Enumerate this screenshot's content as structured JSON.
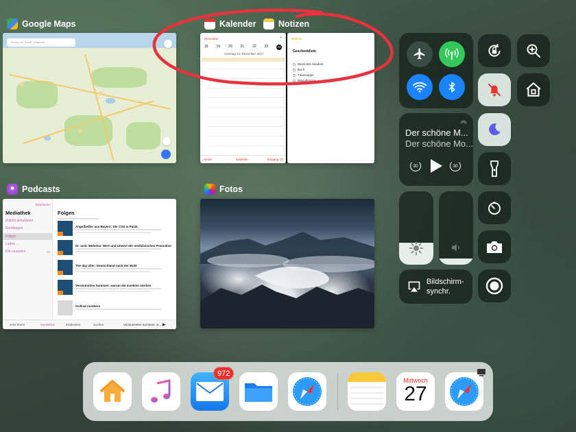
{
  "apps": {
    "maps": {
      "label": "Google Maps",
      "search_placeholder": "Suche auf \"Karte\" eingeben"
    },
    "calendar": {
      "label": "Kalender",
      "back": "Dezember",
      "days": [
        "18",
        "19",
        "20",
        "21",
        "22",
        "23",
        "24"
      ],
      "date_line": "Sonntag  24. Dezember 2017",
      "bottom_left": "Heute",
      "bottom_mid": "Kalender",
      "bottom_right": "Eingang (0)"
    },
    "notes": {
      "label": "Notizen",
      "back": "Notizen",
      "title": "Geschenkliste",
      "items": [
        "Bluetooth-Headset",
        "Buch",
        "Tütensuppe",
        "Wärmflasche"
      ]
    },
    "podcasts": {
      "label": "Podcasts",
      "sidebar_title": "Mediathek",
      "edit": "Bearbeiten",
      "sidebar_items": [
        "Zuletzt aktualisiert",
        "Sendungen",
        "Folgen",
        "Laden ...",
        "Die neuesten"
      ],
      "newest_count": "10",
      "main_title": "Folgen",
      "episodes": [
        "Angstbeißer aus Bayern: Die CSU in Panik",
        "Dr. med. Mühelos: Wert und Unwert der medizinischen Promotion",
        "The day after: Deutschland nach der Wahl",
        "Verstummtes Summen: warum die Insekten sterben",
        "Ordinal numbers"
      ],
      "tabbar": [
        "Jetzt hören",
        "Mediathek",
        "Entdecken",
        "Suchen"
      ],
      "now_playing": "Verstummtes Summen: w..."
    },
    "photos": {
      "label": "Fotos"
    }
  },
  "control_center": {
    "now_playing_title": "Der schöne M...",
    "now_playing_subtitle": "Der schöne Mo...",
    "skip_back": "30",
    "skip_forward": "30",
    "brightness_level": 0.3,
    "volume_level": 0.08,
    "screen_mirroring_label": "Bildschirm-synchr."
  },
  "dock": {
    "mail_badge": "972",
    "calendar_weekday": "Mittwoch",
    "calendar_day": "27",
    "apps": [
      "Home",
      "Music",
      "Mail",
      "Files",
      "Safari",
      "Notes",
      "Calendar",
      "Safari"
    ]
  },
  "colors": {
    "annotation": "#e8323e",
    "airplane": "#3a4a44",
    "cellular": "#34c759",
    "wifi": "#1a84ff",
    "bluetooth": "#1a84ff",
    "dnd": "#5e5ce6",
    "badge": "#e8332c"
  }
}
